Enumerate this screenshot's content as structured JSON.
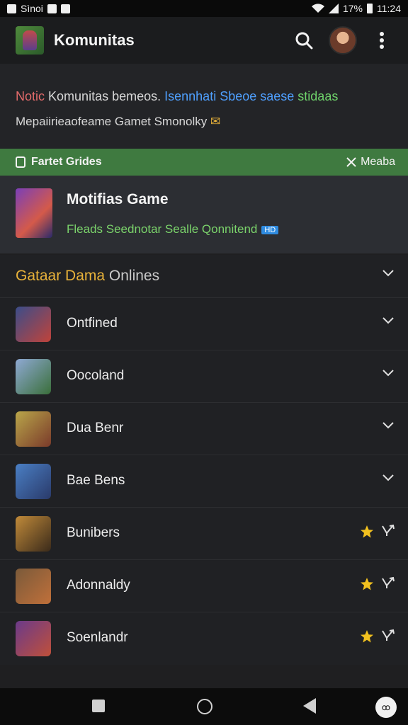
{
  "status_bar": {
    "carrier": "Sìnoi",
    "battery": "17%",
    "time": "11:24"
  },
  "app_bar": {
    "title": "Komunitas"
  },
  "notice": {
    "line1_part1": "Notic",
    "line1_part2": "Komunitas bemeos.",
    "line1_part3": "Isennhati Sbeoe saese",
    "line1_part4": "stidaas",
    "line2": "Mepaiirieaofeame Gamet Smonolky"
  },
  "green_bar": {
    "left_label": "Fartet Grides",
    "right_label": "Meaba"
  },
  "featured": {
    "title": "Motifias Game",
    "subtitle": "Fleads Seednotar Sealle Qonnitend",
    "badge": "HD"
  },
  "section": {
    "title_part1": "Gataar Dama",
    "title_part2": "Onlines"
  },
  "list_items": [
    {
      "label": "Ontfined",
      "trailing": "chevron"
    },
    {
      "label": "Oocoland",
      "trailing": "chevron"
    },
    {
      "label": "Dua Benr",
      "trailing": "chevron"
    },
    {
      "label": "Bae Bens",
      "trailing": "chevron"
    },
    {
      "label": "Bunibers",
      "trailing": "star"
    },
    {
      "label": "Adonnaldy",
      "trailing": "star"
    },
    {
      "label": "Soenlandr",
      "trailing": "star"
    }
  ],
  "nav_bar": {
    "bubble": "ꝏ"
  },
  "colors": {
    "accent_green": "#3f7a40",
    "accent_yellow": "#e8b23a",
    "link_blue": "#4fa0ff"
  }
}
